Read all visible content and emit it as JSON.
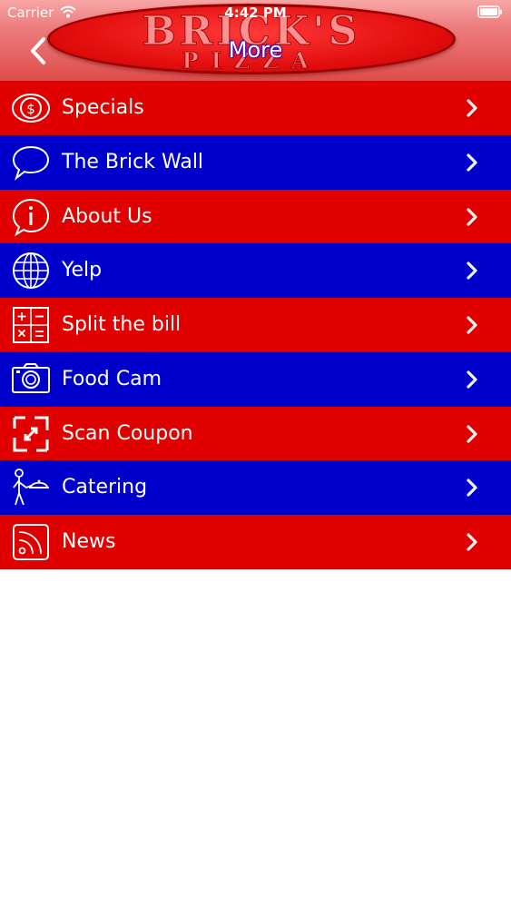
{
  "status_bar": {
    "carrier": "Carrier",
    "time": "4:42 PM"
  },
  "header": {
    "logo_line1": "BRICK'S",
    "logo_line2": "PIZZA",
    "title": "More",
    "back_icon": "chevron-left-icon"
  },
  "colors": {
    "red": "#e00000",
    "blue": "#0000cc",
    "text": "#ffffff"
  },
  "menu": {
    "items": [
      {
        "label": "Specials",
        "icon": "dollar-icon",
        "color": "red"
      },
      {
        "label": "The Brick Wall",
        "icon": "speech-bubble-icon",
        "color": "blue"
      },
      {
        "label": "About Us",
        "icon": "info-icon",
        "color": "red"
      },
      {
        "label": "Yelp",
        "icon": "globe-icon",
        "color": "blue"
      },
      {
        "label": "Split the bill",
        "icon": "calculator-icon",
        "color": "red"
      },
      {
        "label": "Food Cam",
        "icon": "camera-icon",
        "color": "blue"
      },
      {
        "label": "Scan Coupon",
        "icon": "scan-icon",
        "color": "red"
      },
      {
        "label": "Catering",
        "icon": "waiter-icon",
        "color": "blue"
      },
      {
        "label": "News",
        "icon": "rss-icon",
        "color": "red"
      }
    ]
  }
}
